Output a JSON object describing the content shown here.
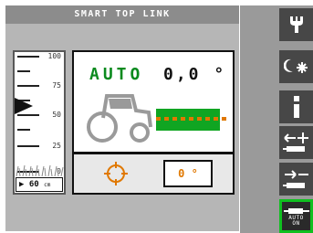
{
  "title": "SMART TOP LINK",
  "scale": {
    "ticks": [
      "100",
      "75",
      "50",
      "25",
      "0"
    ],
    "value": "60",
    "unit": "cm"
  },
  "display": {
    "mode": "AUTO",
    "angle": "0,0 °",
    "setpoint": "0 °"
  },
  "colors": {
    "auto_green": "#0a8a1e",
    "implement_green": "#10a522",
    "orange_accent": "#e07800",
    "active_border": "#10c020"
  },
  "buttons": [
    {
      "icon": "wrench-icon"
    },
    {
      "icon": "day-night-icon"
    },
    {
      "icon": "info-icon"
    },
    {
      "icon": "extend-plus-icon"
    },
    {
      "icon": "retract-minus-icon"
    },
    {
      "icon": "cylinder-auto-icon",
      "label_line1": "AUTO",
      "label_line2": "ON"
    }
  ]
}
